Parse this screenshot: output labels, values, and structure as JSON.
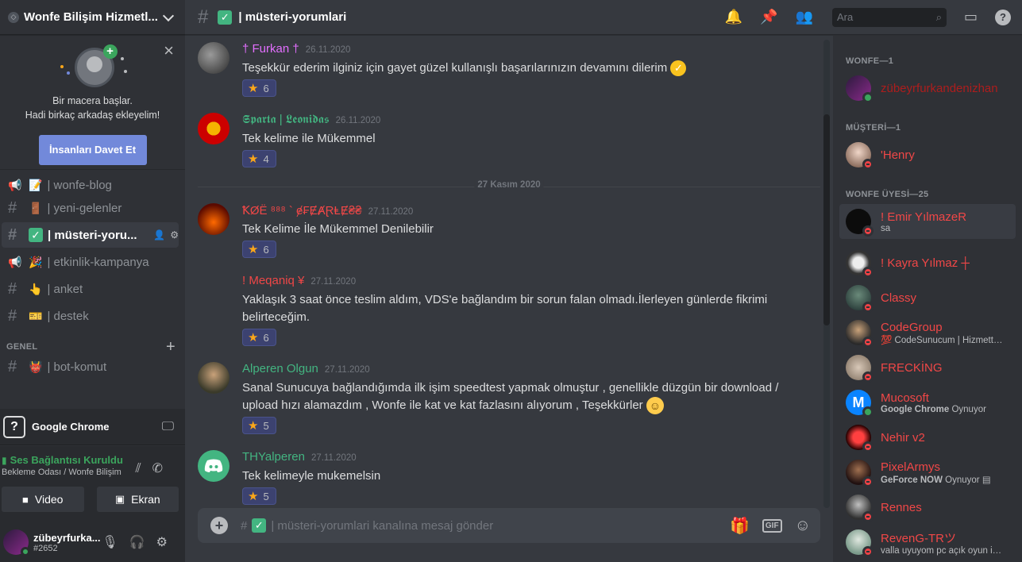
{
  "server": {
    "name": "Wonfe Bilişim Hizmetl..."
  },
  "invite": {
    "line1": "Bir macera başlar.",
    "line2": "Hadi birkaç arkadaş ekleyelim!",
    "button": "İnsanları Davet Et"
  },
  "channels": [
    {
      "name": "| wonfe-blog",
      "emoji": "📝",
      "type": "announce"
    },
    {
      "name": "| yeni-gelenler",
      "emoji": "🚪",
      "type": "text"
    },
    {
      "name": "| müsteri-yoru...",
      "emoji": "✅",
      "type": "text",
      "active": true
    },
    {
      "name": "| etkinlik-kampanya",
      "emoji": "🎉",
      "type": "announce"
    },
    {
      "name": "| anket",
      "emoji": "👆",
      "type": "text"
    },
    {
      "name": "| destek",
      "emoji": "🎫",
      "type": "text"
    }
  ],
  "category": {
    "name": "GENEL"
  },
  "category_channel": {
    "name": "| bot-komut",
    "emoji": "👹"
  },
  "activity": {
    "name": "Google Chrome"
  },
  "voice": {
    "status": "Ses Bağlantısı Kuruldu",
    "location": "Bekleme Odası / Wonfe Bilişim",
    "video": "Video",
    "screen": "Ekran"
  },
  "user": {
    "name": "zübeyrfurka...",
    "tag": "#2652"
  },
  "topbar": {
    "channel": "| müsteri-yorumlari",
    "search_placeholder": "Ara"
  },
  "date_divider": "27 Kasım 2020",
  "messages": [
    {
      "author": "† Furkan †",
      "color": "#e36fff",
      "time": "26.11.2020",
      "text": "Teşekkür ederim ilginiz için gayet güzel kullanışlı başarılarınızın devamını dilerim",
      "reaction": "6"
    },
    {
      "author": "𝕾𝖕𝖆𝖗𝖙𝖆 | 𝕷𝖊𝖔𝖓𝖎𝖉𝖆𝖘",
      "color": "#43b581",
      "time": "26.11.2020",
      "text": "Tek kelime ile Mükemmel",
      "reaction": "4"
    },
    {
      "author": "ꝀØË ⁸⁸⁸ ` ɇ₣ɆȺⱤⱠɆ₴₴",
      "color": "#f04747",
      "time": "27.11.2020",
      "text": "Tek Kelime İle Mükemmel Denilebilir",
      "reaction": "6"
    },
    {
      "author": "!  Meqaniq ¥",
      "color": "#f04747",
      "time": "27.11.2020",
      "text": "Yaklaşık 3 saat önce teslim aldım, VDS'e bağlandım bir sorun falan olmadı.İlerleyen günlerde fikrimi",
      "text2": "belirteceğim.",
      "reaction": "6"
    },
    {
      "author": "Alperen Olgun",
      "color": "#43b581",
      "time": "27.11.2020",
      "text": "Sanal Sunucuya bağlandığımda ilk işim speedtest yapmak olmuştur , genellikle düzgün bir download /",
      "text2": "upload hızı alamazdım , Wonfe ile kat ve kat fazlasını alıyorum , Teşekkürler",
      "reaction": "5"
    },
    {
      "author": "THYalperen",
      "color": "#43b581",
      "time": "27.11.2020",
      "text": "Tek kelimeyle mukemelsin",
      "reaction": "5"
    }
  ],
  "composer": {
    "placeholder": "| müsteri-yorumlari kanalına mesaj gönder"
  },
  "members": {
    "cat1": "WONFE—1",
    "cat2": "MÜŞTERİ—1",
    "cat3": "WONFE ÜYESİ—25",
    "list1": [
      {
        "name": "zübeyrfurkandenizhan",
        "color": "#ad1d1d",
        "status": "on"
      }
    ],
    "list2": [
      {
        "name": "'Henry",
        "color": "#f04747",
        "status": "dnd"
      }
    ],
    "list3": [
      {
        "name": "! Emir YılmazeR",
        "color": "#f04747",
        "status": "dnd",
        "activity": "sa"
      },
      {
        "name": "! Kayra Yılmaz ┼",
        "color": "#f04747",
        "status": "dnd"
      },
      {
        "name": "Classy",
        "color": "#f04747",
        "status": "dnd"
      },
      {
        "name": "CodeGroup",
        "color": "#f04747",
        "status": "dnd",
        "activity": "💯 CodeSunucum | Hizmette S..."
      },
      {
        "name": "FRECKİNG",
        "color": "#f04747",
        "status": "dnd"
      },
      {
        "name": "Mucosoft",
        "color": "#f04747",
        "status": "on",
        "activity_bold": "Google Chrome",
        "activity": " Oynuyor"
      },
      {
        "name": "Nehir v2",
        "color": "#f04747",
        "status": "dnd"
      },
      {
        "name": "PixelArmys",
        "color": "#f04747",
        "status": "dnd",
        "activity_bold": "GeForce NOW",
        "activity": " Oynuyor ▤"
      },
      {
        "name": "Rennes",
        "color": "#f04747",
        "status": "dnd"
      },
      {
        "name": "RevenG-TRツ",
        "color": "#f04747",
        "status": "dnd",
        "activity": "valla uyuyom pc açık oyun iniyo"
      }
    ]
  }
}
